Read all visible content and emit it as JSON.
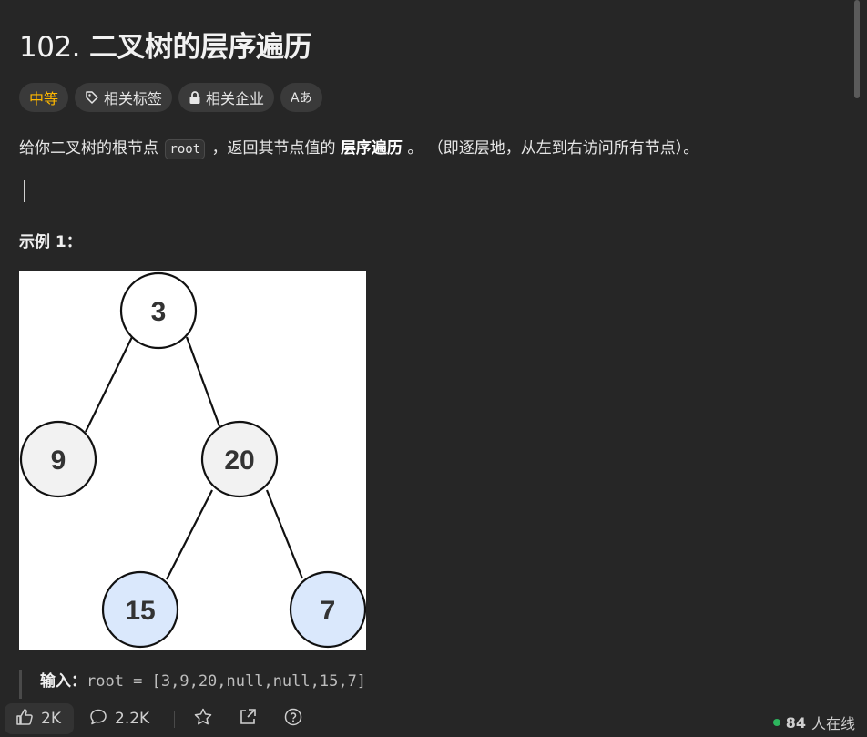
{
  "problem": {
    "number": "102.",
    "title": "二叉树的层序遍历"
  },
  "tags": {
    "difficulty": "中等",
    "related_tags": "相关标签",
    "related_companies": "相关企业",
    "translate_icon": "Aあ"
  },
  "description": {
    "part1": "给你二叉树的根节点 ",
    "code": "root",
    "part2": " ，返回其节点值的 ",
    "bold": "层序遍历",
    "part3": " 。 （即逐层地，从左到右访问所有节点）。"
  },
  "example": {
    "title": "示例 1：",
    "tree_nodes": [
      "3",
      "9",
      "20",
      "15",
      "7"
    ],
    "input_label": "输入：",
    "input_value": "root = [3,9,20,null,null,15,7]"
  },
  "bottom_bar": {
    "likes": "2K",
    "comments": "2.2K",
    "online_count": "84",
    "online_label": "人在线"
  },
  "colors": {
    "background": "#262626",
    "difficulty": "#ffb800",
    "online_dot": "#2db55d",
    "node_gray": "#f2f2f2",
    "node_blue": "#dae8fc"
  }
}
